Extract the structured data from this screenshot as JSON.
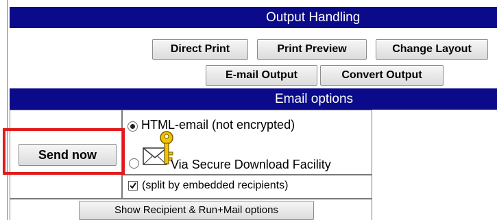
{
  "output_handling": {
    "title": "Output Handling",
    "buttons": {
      "direct_print": "Direct Print",
      "print_preview": "Print Preview",
      "change_layout": "Change Layout",
      "email_output": "E-mail Output",
      "convert_output": "Convert Output"
    }
  },
  "email_options": {
    "title": "Email options",
    "send_now_label": "Send now",
    "options": [
      {
        "label": "HTML-email (not encrypted)",
        "selected": true
      },
      {
        "label": "Via Secure Download Facility",
        "selected": false
      }
    ],
    "split_label": "(split by embedded recipients)",
    "split_checked": true,
    "show_options_label": "Show Recipient & Run+Mail options"
  },
  "colors": {
    "header_bar": "#0a0a8a",
    "highlight": "#e01b1b"
  },
  "icons": [
    "envelope-key-icon",
    "checkmark-icon"
  ]
}
